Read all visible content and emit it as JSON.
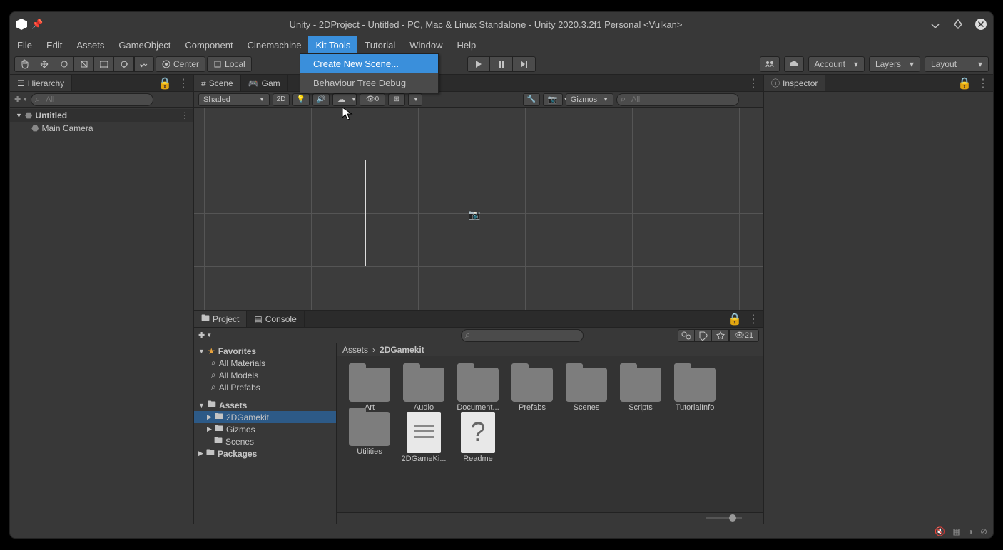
{
  "titlebar": {
    "title": "Unity - 2DProject - Untitled - PC, Mac & Linux Standalone - Unity 2020.3.2f1 Personal <Vulkan>"
  },
  "menubar": {
    "items": [
      "File",
      "Edit",
      "Assets",
      "GameObject",
      "Component",
      "Cinemachine",
      "Kit Tools",
      "Tutorial",
      "Window",
      "Help"
    ],
    "active": "Kit Tools",
    "dropdown": {
      "items": [
        "Create New Scene...",
        "Behaviour Tree Debug"
      ],
      "hover": "Create New Scene..."
    }
  },
  "toolbar": {
    "pivot": "Center",
    "handle": "Local",
    "account": "Account",
    "layers": "Layers",
    "layout": "Layout"
  },
  "hierarchy": {
    "title": "Hierarchy",
    "search_placeholder": "All",
    "tree": {
      "root": "Untitled",
      "children": [
        "Main Camera"
      ]
    }
  },
  "scene": {
    "tab_scene": "Scene",
    "tab_game": "Gam",
    "shading": "Shaded",
    "mode2d": "2D",
    "gizmos": "Gizmos",
    "search_placeholder": "All",
    "vis_count": "0"
  },
  "inspector": {
    "title": "Inspector"
  },
  "project": {
    "tab_project": "Project",
    "tab_console": "Console",
    "hidden_count": "21",
    "tree": {
      "favorites": "Favorites",
      "fav_items": [
        "All Materials",
        "All Models",
        "All Prefabs"
      ],
      "assets": "Assets",
      "asset_items": [
        "2DGamekit",
        "Gizmos",
        "Scenes"
      ],
      "packages": "Packages"
    },
    "breadcrumb": [
      "Assets",
      "2DGamekit"
    ],
    "assets": [
      {
        "name": "Art",
        "type": "folder"
      },
      {
        "name": "Audio",
        "type": "folder"
      },
      {
        "name": "Document...",
        "type": "folder"
      },
      {
        "name": "Prefabs",
        "type": "folder"
      },
      {
        "name": "Scenes",
        "type": "folder"
      },
      {
        "name": "Scripts",
        "type": "folder"
      },
      {
        "name": "TutorialInfo",
        "type": "folder"
      },
      {
        "name": "Utilities",
        "type": "folder"
      },
      {
        "name": "2DGameKi...",
        "type": "file-lines"
      },
      {
        "name": "Readme",
        "type": "file-q"
      }
    ]
  }
}
